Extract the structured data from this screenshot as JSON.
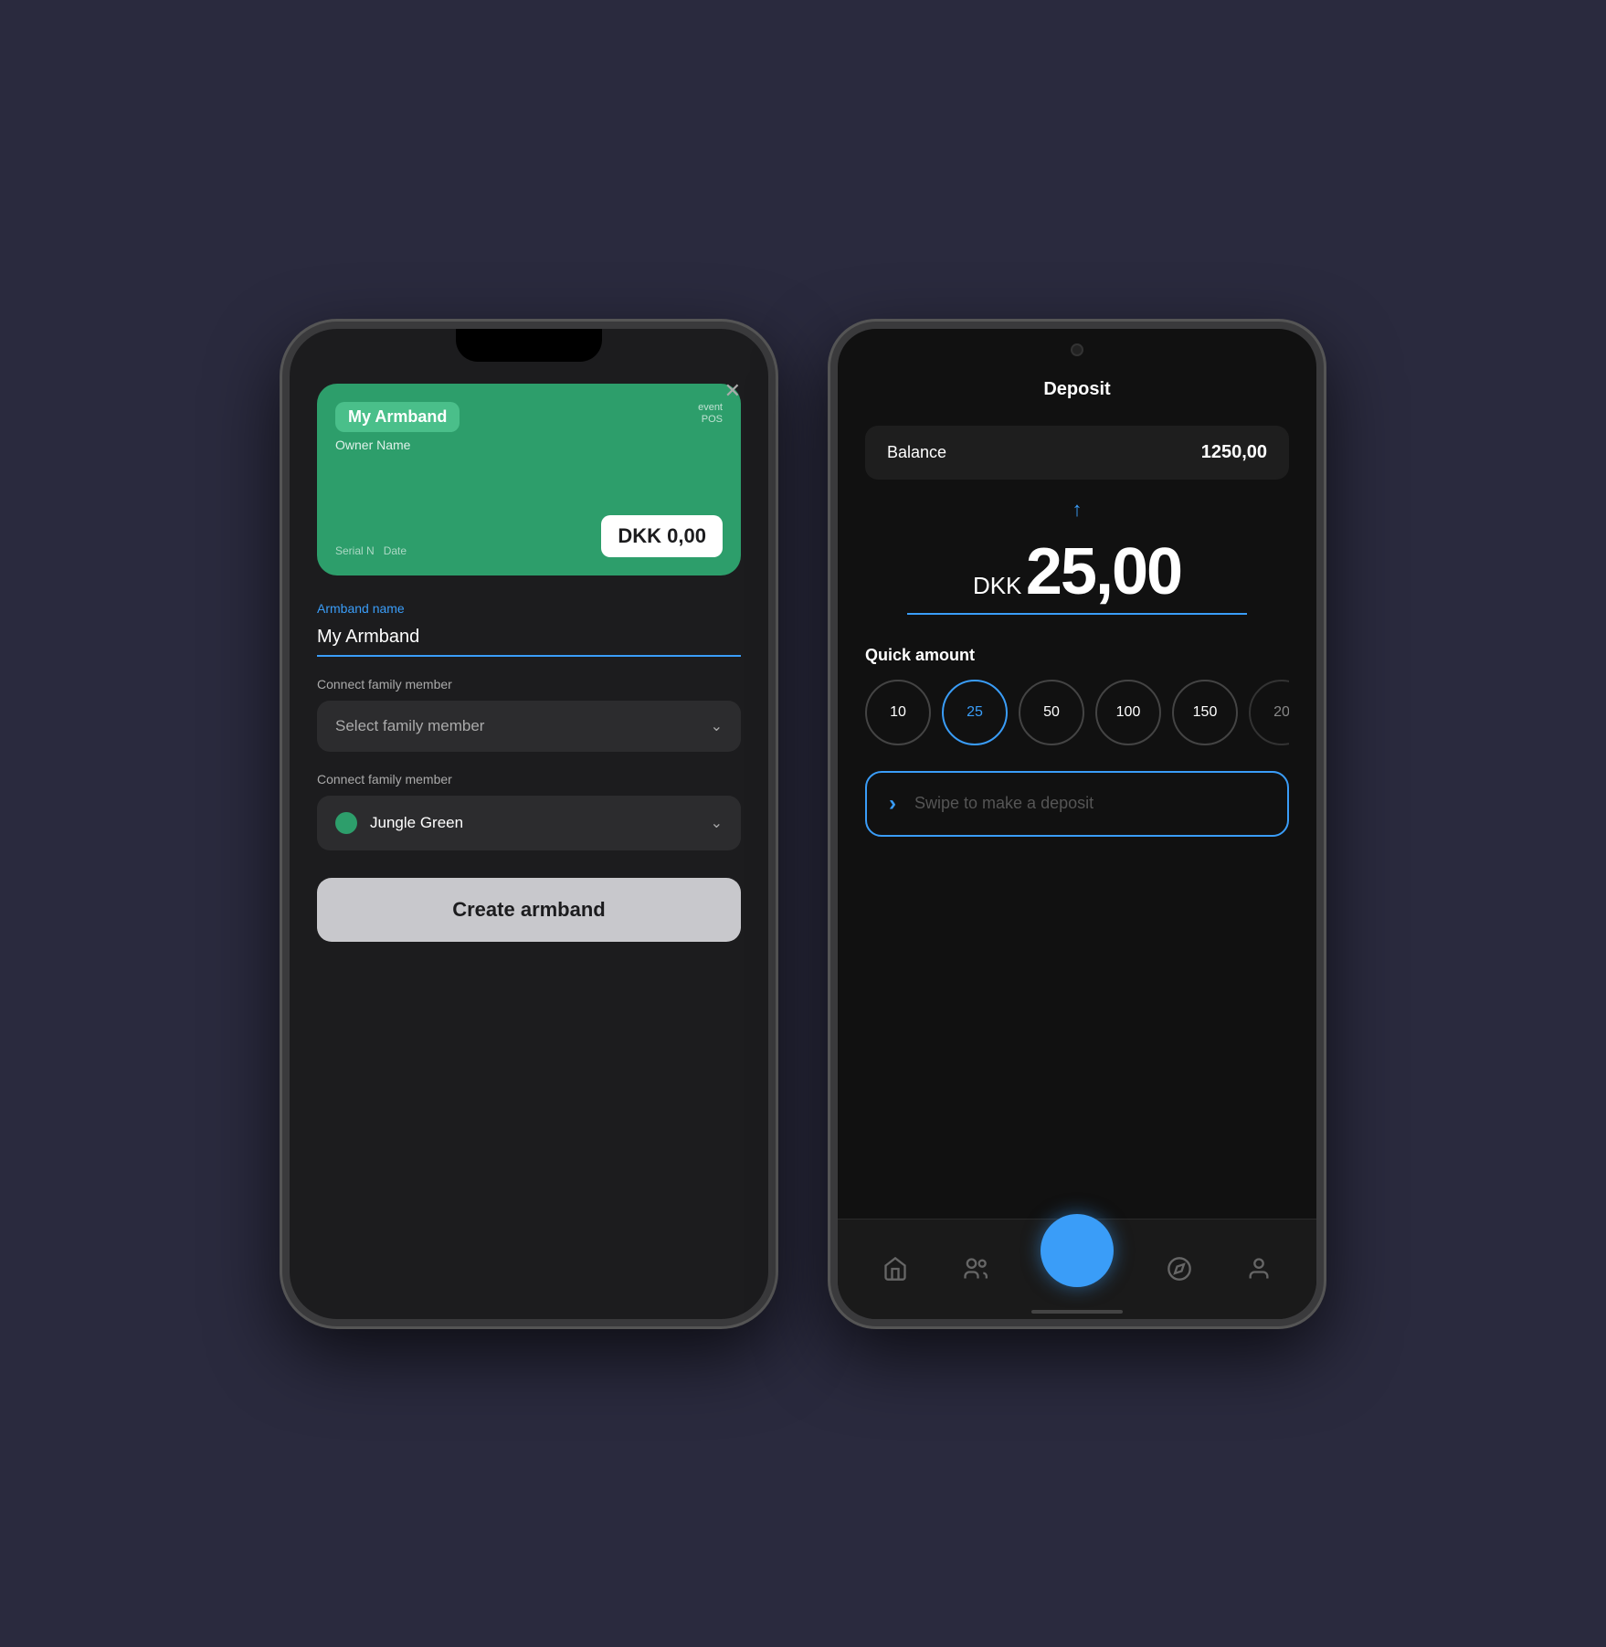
{
  "iphone": {
    "close_icon": "✕",
    "card": {
      "name": "My Armband",
      "owner": "Owner Name",
      "logo": "event\nPOS",
      "serial_label": "Serial N",
      "date_label": "Date",
      "balance_label": "DKK",
      "balance_value": "0,00"
    },
    "form": {
      "armband_name_label": "Armband name",
      "armband_name_value": "My Armband",
      "connect_family_label1": "Connect family member",
      "select_placeholder": "Select family member",
      "connect_family_label2": "Connect family member",
      "color_value": "Jungle Green",
      "create_btn": "Create armband"
    }
  },
  "android": {
    "title": "Deposit",
    "balance_label": "Balance",
    "balance_value": "1250,00",
    "currency": "DKK",
    "amount": "25,00",
    "up_arrow": "↑",
    "quick_label": "Quick amount",
    "quick_amounts": [
      {
        "value": "10",
        "active": false
      },
      {
        "value": "25",
        "active": true
      },
      {
        "value": "50",
        "active": false
      },
      {
        "value": "100",
        "active": false
      },
      {
        "value": "150",
        "active": false
      },
      {
        "value": "20",
        "active": false,
        "partial": true
      }
    ],
    "swipe_icon": "›",
    "swipe_text": "Swipe to make a deposit",
    "nav": {
      "home_icon": "⌂",
      "group_icon": "⚇",
      "compass_icon": "◎",
      "profile_icon": "⚇"
    }
  }
}
